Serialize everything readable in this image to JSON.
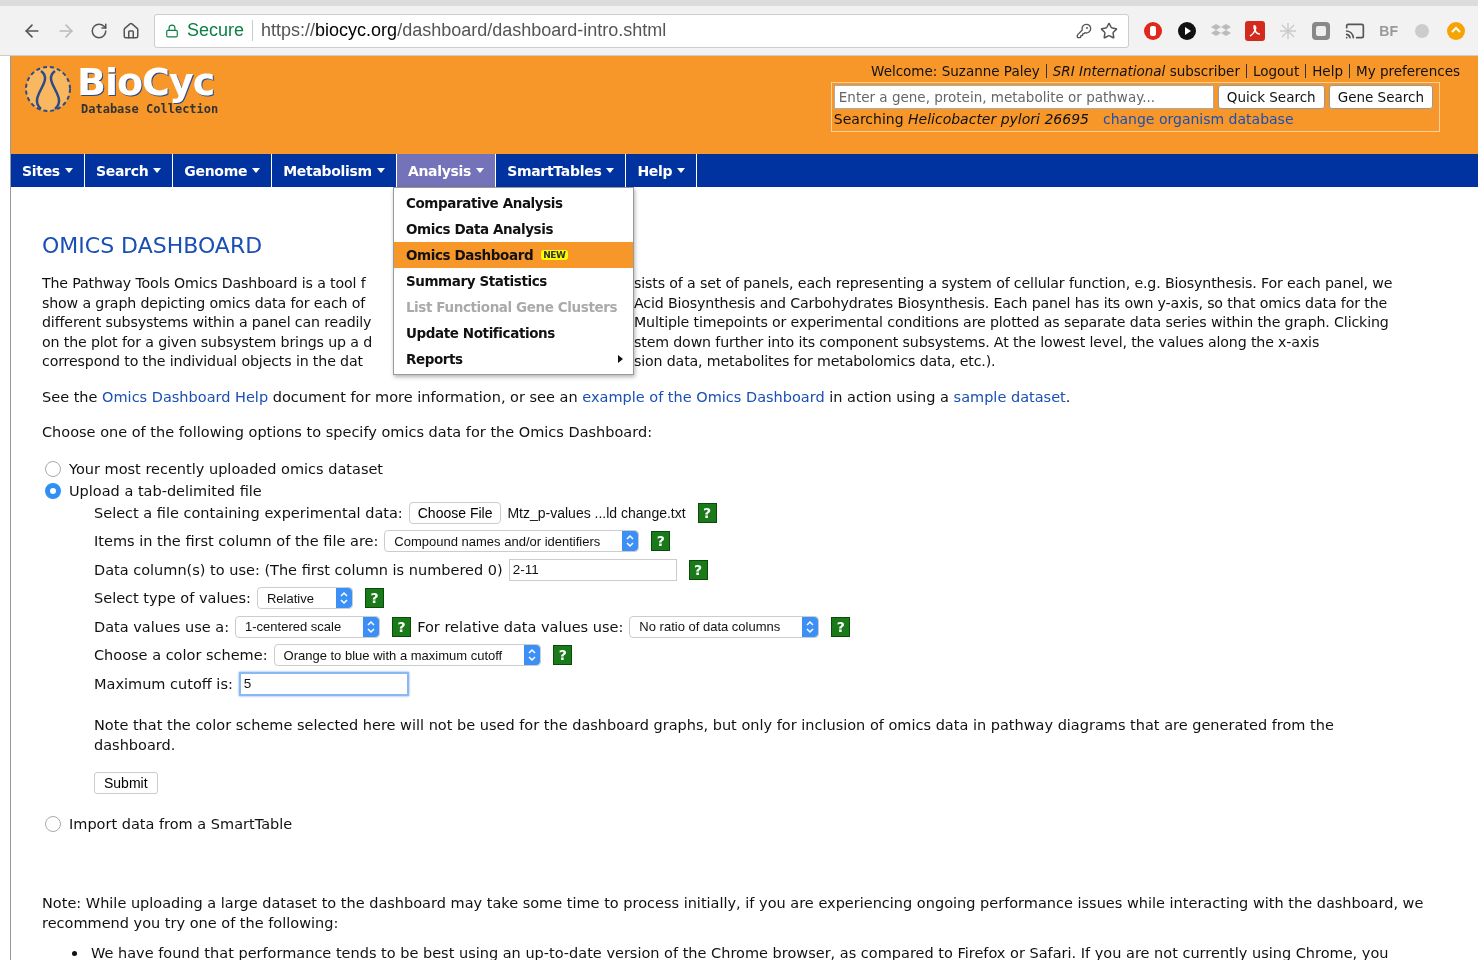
{
  "browser": {
    "secure_label": "Secure",
    "url_scheme": "https://",
    "url_host": "biocyc.org",
    "url_path": "/dashboard/dashboard-intro.shtml",
    "extension_text": "BF"
  },
  "header": {
    "logo_title": "BioCyc",
    "logo_subtitle": "Database Collection",
    "top_links": [
      "Welcome: Suzanne Paley",
      "*SRI International* subscriber",
      "Logout",
      "Help",
      "My preferences"
    ],
    "search": {
      "placeholder": "Enter a gene, protein, metabolite or pathway...",
      "buttons": [
        "Quick Search",
        "Gene Search"
      ],
      "searching": "Searching *Helicobacter pylori 26695*",
      "change_link": "change organism database"
    }
  },
  "nav": [
    {
      "label": "Sites",
      "selected": false
    },
    {
      "label": "Search",
      "selected": false
    },
    {
      "label": "Genome",
      "selected": false
    },
    {
      "label": "Metabolism",
      "selected": false
    },
    {
      "label": "Analysis",
      "selected": true
    },
    {
      "label": "SmartTables",
      "selected": false
    },
    {
      "label": "Help",
      "selected": false
    }
  ],
  "menu": [
    {
      "label": "Comparative Analysis",
      "selected": false,
      "disabled": false,
      "submenu": false
    },
    {
      "label": "Omics Data Analysis",
      "selected": false,
      "disabled": false,
      "submenu": false
    },
    {
      "label": "Omics Dashboard",
      "selected": true,
      "disabled": false,
      "submenu": false,
      "badge": "NEW"
    },
    {
      "label": "Summary Statistics",
      "selected": false,
      "disabled": false,
      "submenu": false
    },
    {
      "label": "List Functional Gene Clusters",
      "selected": false,
      "disabled": true,
      "submenu": false
    },
    {
      "label": "Update Notifications",
      "selected": false,
      "disabled": false,
      "submenu": false
    },
    {
      "label": "Reports",
      "selected": false,
      "disabled": false,
      "submenu": true
    }
  ],
  "title": "OMICS DASHBOARD",
  "intro_lines": [
    {
      "left": "The Pathway Tools Omics Dashboard is a tool f",
      "right": "sists of a set of panels, each representing a system of cellular function, e.g. Biosynthesis. For each panel, we"
    },
    {
      "left": "show a graph depicting omics data for each of",
      "right": "Acid Biosynthesis and Carbohydrates Biosynthesis. Each panel has its own y-axis, so that omics data for the"
    },
    {
      "left": "different subsystems within a panel can readily",
      "right": "Multiple timepoints or experimental conditions are plotted as separate data series within the graph. Clicking"
    },
    {
      "left": "on the plot for a given subsystem brings up a d",
      "right": "stem down further into its component subsystems. At the lowest level, the values along the x-axis"
    },
    {
      "left": "correspond to the individual objects in the dat",
      "right": "sion data, metabolites for metabolomics data, etc.)."
    }
  ],
  "see_also": [
    {
      "kind": "text",
      "text": "See the"
    },
    {
      "kind": "link",
      "text": "Omics Dashboard Help"
    },
    {
      "kind": "text",
      "text": "document for more information, or see an"
    },
    {
      "kind": "link",
      "text": "example of the Omics Dashboard"
    },
    {
      "kind": "text",
      "text": "in action using a"
    },
    {
      "kind": "link",
      "text": "sample dataset"
    },
    {
      "kind": "text",
      "text": "."
    }
  ],
  "choose_text": "Choose one of the following options to specify omics data for the Omics Dashboard:",
  "options": [
    {
      "label": "Your most recently uploaded omics dataset",
      "selected": false
    },
    {
      "label": "Upload a tab-delimited file",
      "selected": true,
      "form": true
    },
    {
      "label": "Import data from a SmartTable",
      "selected": false
    }
  ],
  "form_rows": [
    [
      {
        "kind": "label",
        "text": "Select a file containing experimental data:"
      },
      {
        "kind": "file",
        "button": "Choose File",
        "filename": "Mtz_p-values ...ld change.txt"
      },
      {
        "kind": "help",
        "text": "?"
      }
    ],
    [
      {
        "kind": "label",
        "text": "Items in the first column of the file are:"
      },
      {
        "kind": "select",
        "value": "Compound names and/or identifiers"
      },
      {
        "kind": "help",
        "text": "?"
      }
    ],
    [
      {
        "kind": "label",
        "text": "Data column(s) to use: (The first column is numbered 0)"
      },
      {
        "kind": "input",
        "value": "2-11",
        "focused": false
      },
      {
        "kind": "help",
        "text": "?"
      }
    ],
    [
      {
        "kind": "label",
        "text": "Select type of values:"
      },
      {
        "kind": "select",
        "value": "Relative"
      },
      {
        "kind": "help",
        "text": "?"
      }
    ],
    [
      {
        "kind": "label",
        "text": "Data values use a:"
      },
      {
        "kind": "select",
        "value": "1-centered scale"
      },
      {
        "kind": "help",
        "text": "?"
      },
      {
        "kind": "label",
        "text": "For relative data values use:"
      },
      {
        "kind": "select",
        "value": "No ratio of data columns"
      },
      {
        "kind": "help",
        "text": "?"
      }
    ],
    [
      {
        "kind": "label",
        "text": "Choose a color scheme:"
      },
      {
        "kind": "select",
        "value": "Orange to blue with a maximum cutoff"
      },
      {
        "kind": "help",
        "text": "?"
      }
    ],
    [
      {
        "kind": "label",
        "text": "Maximum cutoff is:"
      },
      {
        "kind": "input",
        "value": "5",
        "focused": true
      }
    ]
  ],
  "form_note": "Note that the color scheme selected here will not be used for the dashboard graphs, but only for inclusion of omics data in pathway diagrams that are generated from the dashboard.",
  "submit": "Submit",
  "bottom_note": "Note: While uploading a large dataset to the dashboard may take some time to process initially, if you are experiencing ongoing performance issues while interacting with the dashboard, we recommend you try one of the following:",
  "bullets": [
    "We have found that performance tends to be best using an up-to-date version of the Chrome browser, as compared to Firefox or Safari. If you are not currently using Chrome, you"
  ]
}
